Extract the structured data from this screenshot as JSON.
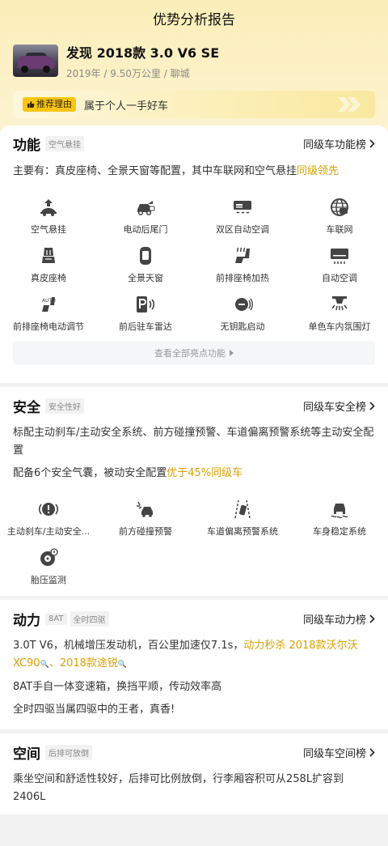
{
  "header": {
    "title": "优势分析报告"
  },
  "car": {
    "title": "发现 2018款 3.0 V6 SE",
    "subtitle": "2019年 / 9.50万公里 / 聊城"
  },
  "reason": {
    "badge": "推荐理由",
    "text": "属于个人一手好车"
  },
  "function": {
    "title": "功能",
    "tag": "空气悬挂",
    "rank_link": "同级车功能榜",
    "desc_prefix": "主要有：真皮座椅、全景天窗等配置，其中车联网和空气悬挂",
    "desc_highlight": "同级领先",
    "features": [
      {
        "label": "空气悬挂",
        "icon": "air-suspension-icon"
      },
      {
        "label": "电动后尾门",
        "icon": "power-tailgate-icon"
      },
      {
        "label": "双区自动空调",
        "icon": "dual-zone-ac-icon"
      },
      {
        "label": "车联网",
        "icon": "telematics-icon"
      },
      {
        "label": "真皮座椅",
        "icon": "leather-seat-icon"
      },
      {
        "label": "全景天窗",
        "icon": "panoramic-sunroof-icon"
      },
      {
        "label": "前排座椅加热",
        "icon": "seat-heating-icon"
      },
      {
        "label": "自动空调",
        "icon": "auto-ac-icon"
      },
      {
        "label": "前排座椅电动调节",
        "icon": "power-seat-icon"
      },
      {
        "label": "前后驻车雷达",
        "icon": "parking-radar-icon"
      },
      {
        "label": "无钥匙启动",
        "icon": "keyless-start-icon"
      },
      {
        "label": "单色车内氛围灯",
        "icon": "ambient-light-icon"
      }
    ],
    "more_label": "查看全部亮点功能"
  },
  "safety": {
    "title": "安全",
    "tag": "安全性好",
    "rank_link": "同级车安全榜",
    "desc1": "标配主动刹车/主动安全系统、前方碰撞预警、车道偏离预警系统等主动安全配置",
    "desc2_prefix": "配备6个安全气囊，被动安全配置",
    "desc2_highlight": "优于45%同级车",
    "features": [
      {
        "label": "主动刹车/主动安全...",
        "icon": "active-brake-icon"
      },
      {
        "label": "前方碰撞预警",
        "icon": "collision-warning-icon"
      },
      {
        "label": "车道偏离预警系统",
        "icon": "lane-departure-icon"
      },
      {
        "label": "车身稳定系统",
        "icon": "stability-control-icon"
      },
      {
        "label": "胎压监测",
        "icon": "tire-pressure-icon"
      }
    ]
  },
  "power": {
    "title": "动力",
    "tags": [
      "8AT",
      "全时四驱"
    ],
    "rank_link": "同级车动力榜",
    "desc1_prefix": "3.0T V6，机械增压发动机，百公里加速仅7.1s，",
    "desc1_highlight_a": "动力秒杀 2018款沃尔沃XC90",
    "desc1_sep": "、",
    "desc1_highlight_b": "2018款途锐",
    "desc2": "8AT手自一体变速箱，换挡平顺，传动效率高",
    "desc3": "全时四驱当属四驱中的王者，真香!"
  },
  "space": {
    "title": "空间",
    "tag": "后排可放倒",
    "rank_link": "同级车空间榜",
    "desc": "乘坐空间和舒适性较好，后排可比例放倒，行李厢容积可从258L扩容到2406L"
  }
}
